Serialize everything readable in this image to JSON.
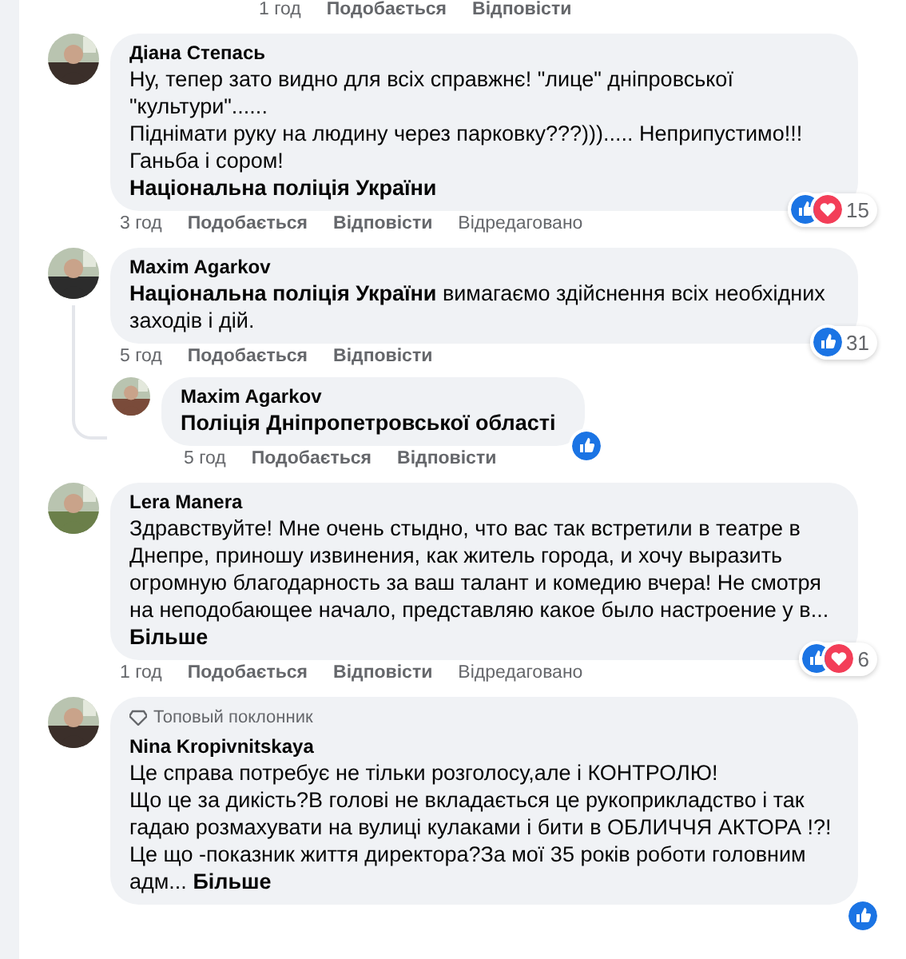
{
  "top_actions": {
    "time": "1 год",
    "like": "Подобається",
    "reply": "Відповісти"
  },
  "comments": [
    {
      "author": "Діана Степась",
      "body": "Ну, тепер зато видно для всіх справжнє! \"лице\" дніпровської \"культури\"......\nПіднімати руку на людину через парковку???))).....  Неприпустимо!!! Ганьба і сором!\n**Національна поліція України**",
      "time": "3 год",
      "like": "Подобається",
      "reply": "Відповісти",
      "edited": "Відредаговано",
      "love": true,
      "reaction_count": "15"
    },
    {
      "author": "Maxim Agarkov",
      "body": "**Національна поліція України** вимагаємо здійснення всіх необхідних заходів і дій.",
      "time": "5 год",
      "like": "Подобається",
      "reply": "Відповісти",
      "love": false,
      "reaction_count": "31",
      "replies": [
        {
          "author": "Maxim Agarkov",
          "body": "**Поліція Дніпропетровської області**",
          "time": "5 год",
          "like": "Подобається",
          "reply": "Відповісти",
          "love": false
        }
      ]
    },
    {
      "author": "Lera Manera",
      "body": "Здравствуйте! Мне очень стыдно, что вас так встретили в театре в Днепре, приношу извинения, как житель города, и хочу выразить огромную благодарность за ваш талант и комедию вчера! Не смотря на неподобающее начало, представляю какое было настроение у в...",
      "more": "Більше",
      "time": "1 год",
      "like": "Подобається",
      "reply": "Відповісти",
      "edited": "Відредаговано",
      "love": true,
      "reaction_count": "6"
    },
    {
      "author": "Nina Kropivnitskaya",
      "badge": "Топовый поклонник",
      "body": "Це справа потребує не тільки розголосу,але і КОНТРОЛЮ!\nЩо це за дикість?В голові не вкладається це рукоприкладство і так гадаю розмахувати на вулиці кулаками і бити в ОБЛИЧЧЯ АКТОРА !?!Це що -показник життя директора?За мої 35 років роботи головним адм...",
      "more": "Більше"
    }
  ]
}
